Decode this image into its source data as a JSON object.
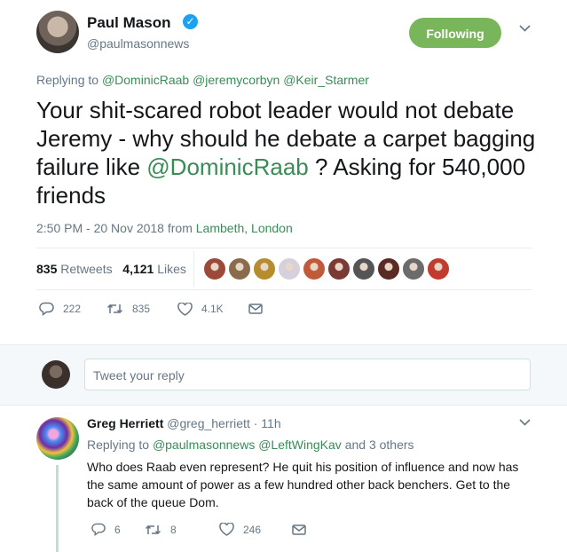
{
  "tweet": {
    "author_name": "Paul Mason",
    "author_handle": "@paulmasonnews",
    "follow_label": "Following",
    "replying_prefix": "Replying to",
    "reply_to": [
      "@DominicRaab",
      "@jeremycorbyn",
      "@Keir_Starmer"
    ],
    "text_before": "Your shit-scared robot leader would not debate Jeremy - why should he debate a carpet bagging failure like ",
    "text_mention": "@DominicRaab",
    "text_after": " ? Asking for 540,000 friends",
    "timestamp": "2:50 PM - 20 Nov 2018 from ",
    "location": "Lambeth, London",
    "retweets_count": "835",
    "retweets_label": "Retweets",
    "likes_count": "4,121",
    "likes_label": "Likes",
    "actions": {
      "reply_count": "222",
      "retweet_count": "835",
      "like_count": "4.1K"
    },
    "liker_colors": [
      "#9b4a3a",
      "#8a6b4c",
      "#b58c2e",
      "#d6d0dc",
      "#c05a3a",
      "#7a3b35",
      "#555555",
      "#5a2a25",
      "#6b6b6b",
      "#c23b2f"
    ]
  },
  "compose": {
    "placeholder": "Tweet your reply"
  },
  "reply": {
    "name": "Greg Herriett",
    "handle": "@greg_herriett",
    "time": "· 11h",
    "replying_prefix": "Replying to",
    "reply_to": [
      "@paulmasonnews",
      "@LeftWingKav"
    ],
    "reply_to_more": "and 3 others",
    "text": "Who does Raab even represent? He quit his position of influence and now has the same amount of power as a few hundred other back benchers. Get to the back of the queue Dom.",
    "actions": {
      "reply_count": "6",
      "retweet_count": "8",
      "like_count": "246"
    }
  },
  "colors": {
    "accent": "#3a8c57",
    "follow_button": "#79b55b",
    "verified": "#1da1f2",
    "muted": "#657786"
  }
}
